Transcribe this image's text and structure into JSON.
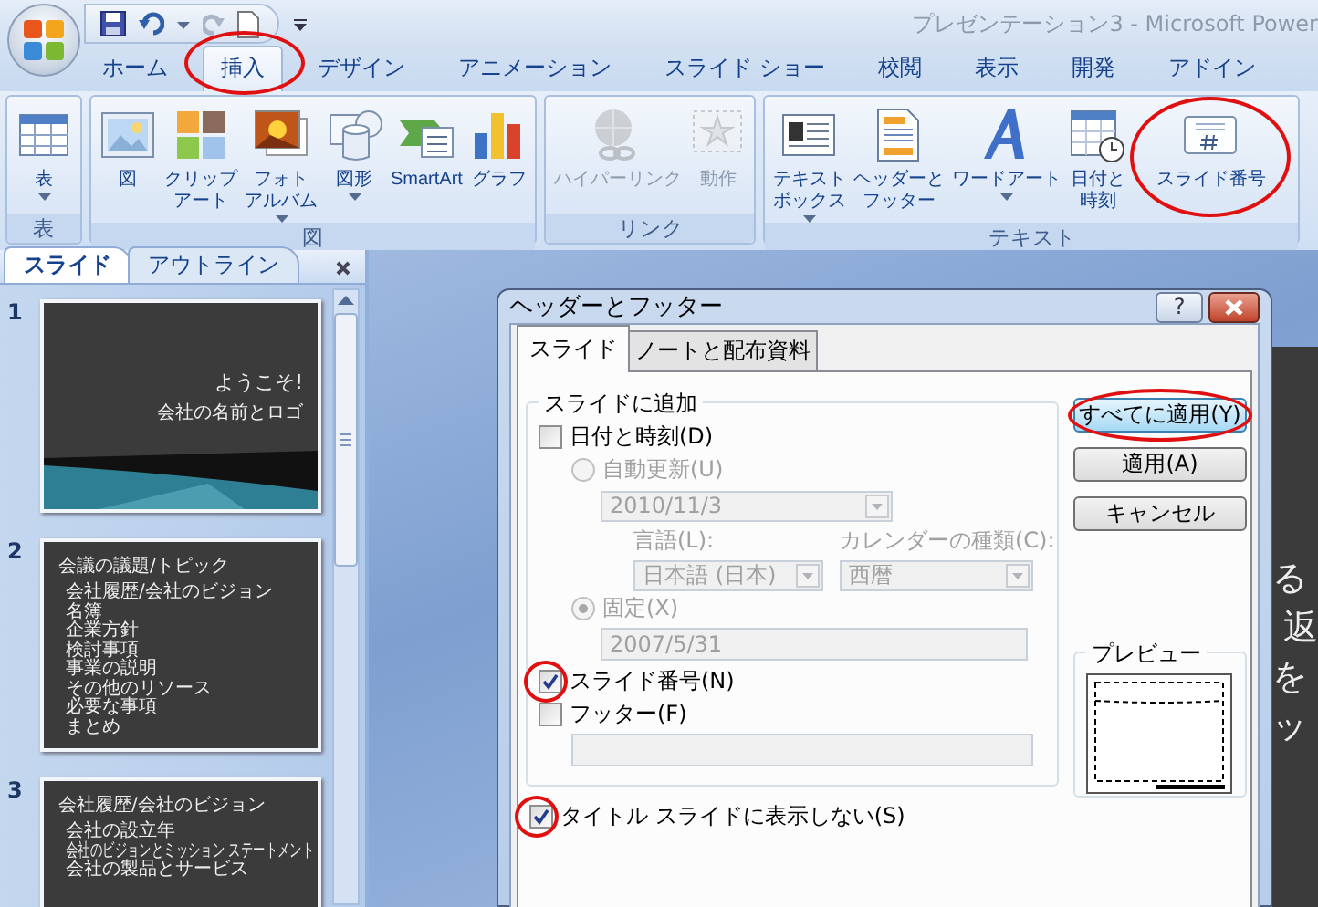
{
  "window": {
    "title": "プレゼンテーション3 - Microsoft Power"
  },
  "ribbon_tabs": [
    {
      "label": "ホーム",
      "selected": false,
      "circled": false
    },
    {
      "label": "挿入",
      "selected": true,
      "circled": true
    },
    {
      "label": "デザイン",
      "selected": false,
      "circled": false
    },
    {
      "label": "アニメーション",
      "selected": false,
      "circled": false
    },
    {
      "label": "スライド ショー",
      "selected": false,
      "circled": false
    },
    {
      "label": "校閲",
      "selected": false,
      "circled": false
    },
    {
      "label": "表示",
      "selected": false,
      "circled": false
    },
    {
      "label": "開発",
      "selected": false,
      "circled": false
    },
    {
      "label": "アドイン",
      "selected": false,
      "circled": false
    }
  ],
  "ribbon_groups": [
    {
      "label": "表",
      "buttons": [
        {
          "kind": "table",
          "label_lines": [
            "表"
          ],
          "has_menu": true,
          "disabled": false,
          "circled": false
        }
      ]
    },
    {
      "label": "図",
      "buttons": [
        {
          "kind": "picture",
          "label_lines": [
            "図"
          ],
          "has_menu": false,
          "disabled": false,
          "circled": false
        },
        {
          "kind": "clipart",
          "label_lines": [
            "クリップ",
            "アート"
          ],
          "has_menu": false,
          "disabled": false,
          "circled": false
        },
        {
          "kind": "photo-album",
          "label_lines": [
            "フォト",
            "アルバム"
          ],
          "has_menu": true,
          "disabled": false,
          "circled": false
        },
        {
          "kind": "shapes",
          "label_lines": [
            "図形"
          ],
          "has_menu": true,
          "disabled": false,
          "circled": false
        },
        {
          "kind": "smartart",
          "label_lines": [
            "SmartArt"
          ],
          "has_menu": false,
          "disabled": false,
          "circled": false
        },
        {
          "kind": "chart",
          "label_lines": [
            "グラフ"
          ],
          "has_menu": false,
          "disabled": false,
          "circled": false
        }
      ]
    },
    {
      "label": "リンク",
      "buttons": [
        {
          "kind": "hyperlink",
          "label_lines": [
            "ハイパーリンク"
          ],
          "has_menu": false,
          "disabled": true,
          "circled": false
        },
        {
          "kind": "action",
          "label_lines": [
            "動作"
          ],
          "has_menu": false,
          "disabled": true,
          "circled": false
        }
      ]
    },
    {
      "label": "テキスト",
      "buttons": [
        {
          "kind": "textbox",
          "label_lines": [
            "テキスト",
            "ボックス"
          ],
          "has_menu": true,
          "disabled": false,
          "circled": false
        },
        {
          "kind": "header-footer",
          "label_lines": [
            "ヘッダーと",
            "フッター"
          ],
          "has_menu": false,
          "disabled": false,
          "circled": false
        },
        {
          "kind": "wordart",
          "label_lines": [
            "ワードアート"
          ],
          "has_menu": true,
          "disabled": false,
          "circled": false
        },
        {
          "kind": "date-time",
          "label_lines": [
            "日付と",
            "時刻"
          ],
          "has_menu": false,
          "disabled": false,
          "circled": false
        },
        {
          "kind": "slide-number",
          "label_lines": [
            "スライド番号"
          ],
          "has_menu": false,
          "disabled": false,
          "circled": true
        }
      ]
    }
  ],
  "slide_pane": {
    "tabs": [
      {
        "label": "スライド",
        "selected": true
      },
      {
        "label": "アウトライン",
        "selected": false
      }
    ],
    "slides": [
      {
        "number": "1",
        "kind": "title",
        "title": "ようこそ!",
        "subtitle": "会社の名前とロゴ"
      },
      {
        "number": "2",
        "kind": "content",
        "title": "会議の議題/トピック",
        "bullets": [
          "会社履歴/会社のビジョン",
          "名簿",
          "企業方針",
          "検討事項",
          "事業の説明",
          "その他のリソース",
          "必要な事項",
          "まとめ"
        ]
      },
      {
        "number": "3",
        "kind": "content",
        "title": "会社履歴/会社のビジョン",
        "bullets": [
          "会社の設立年",
          "会社のビジョンとミッション ステートメント",
          "会社の製品とサービス"
        ]
      }
    ]
  },
  "slide_edge_text": [
    "る",
    "返",
    "を",
    "ッ"
  ],
  "dialog": {
    "title": "ヘッダーとフッター",
    "help_button": "?",
    "tabs": [
      {
        "label": "スライド",
        "selected": true
      },
      {
        "label": "ノートと配布資料",
        "selected": false
      }
    ],
    "group_label": "スライドに追加",
    "date_time": {
      "label": "日付と時刻(D)",
      "checked": false,
      "circled": false
    },
    "auto_update": {
      "label": "自動更新(U)",
      "selected": false,
      "value": "2010/11/3"
    },
    "language": {
      "label": "言語(L):",
      "value": "日本語 (日本)"
    },
    "calendar": {
      "label": "カレンダーの種類(C):",
      "value": "西暦"
    },
    "fixed": {
      "label": "固定(X)",
      "selected": true,
      "value": "2007/5/31"
    },
    "slide_number": {
      "label": "スライド番号(N)",
      "checked": true,
      "circled": true
    },
    "footer": {
      "label": "フッター(F)",
      "checked": false,
      "circled": false
    },
    "hide_on_title": {
      "label": "タイトル スライドに表示しない(S)",
      "checked": true,
      "circled": true
    },
    "buttons": [
      {
        "label": "すべてに適用(Y)",
        "default": true,
        "circled": true
      },
      {
        "label": "適用(A)",
        "default": false,
        "circled": false
      },
      {
        "label": "キャンセル",
        "default": false,
        "circled": false
      }
    ],
    "preview": {
      "label": "プレビュー"
    }
  }
}
